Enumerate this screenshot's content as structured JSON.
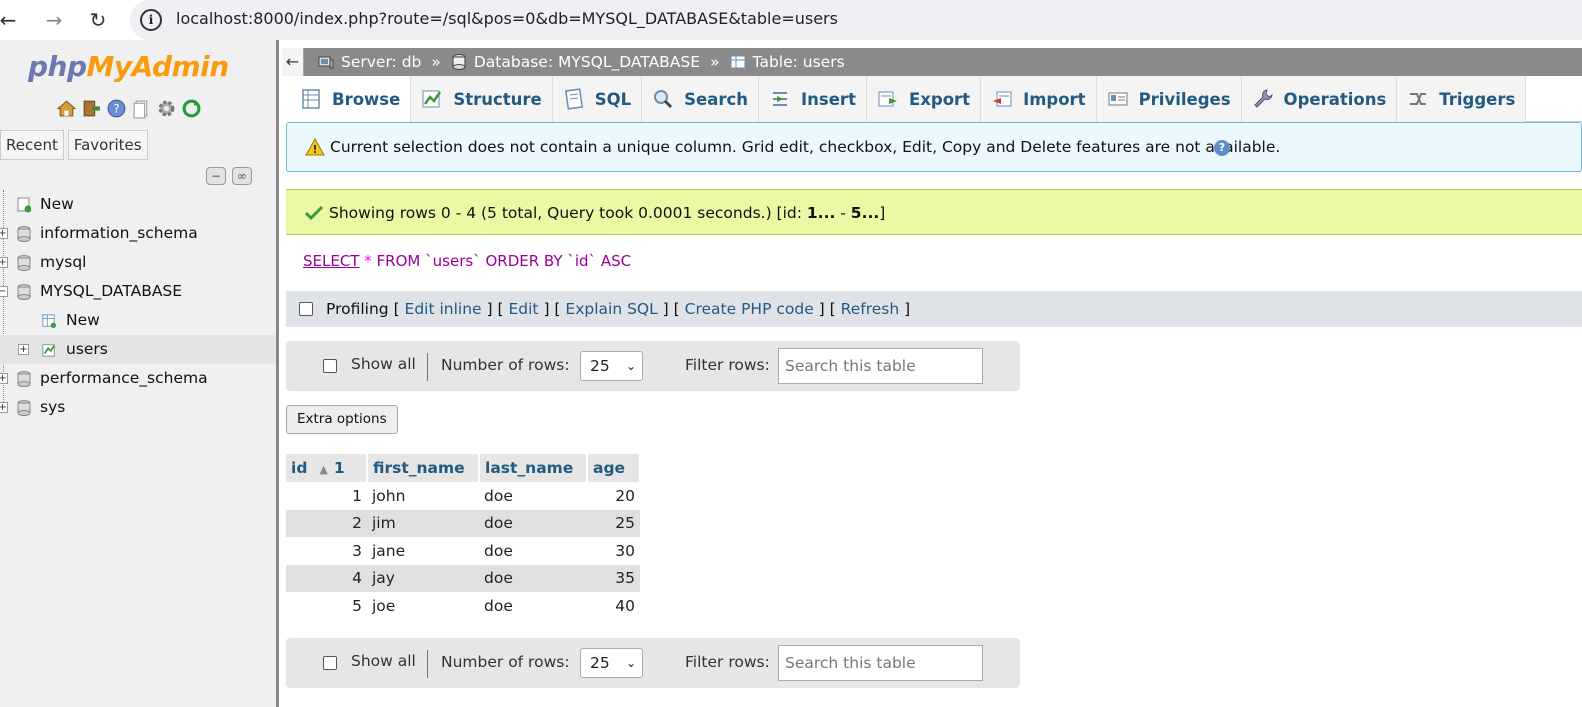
{
  "browser": {
    "url": "localhost:8000/index.php?route=/sql&pos=0&db=MYSQL_DATABASE&table=users"
  },
  "sidebar": {
    "logo_php": "php",
    "logo_myadmin": "MyAdmin",
    "tabs": [
      "Recent",
      "Favorites"
    ],
    "tree": [
      {
        "label": "New",
        "level": 0
      },
      {
        "label": "information_schema",
        "level": 0
      },
      {
        "label": "mysql",
        "level": 0
      },
      {
        "label": "MYSQL_DATABASE",
        "level": 0
      },
      {
        "label": "New",
        "level": 1
      },
      {
        "label": "users",
        "level": 1,
        "selected": true
      },
      {
        "label": "performance_schema",
        "level": 0
      },
      {
        "label": "sys",
        "level": 0
      }
    ]
  },
  "breadcrumb": {
    "server": "Server: db",
    "database": "Database: MYSQL_DATABASE",
    "table": "Table: users",
    "separator": "»"
  },
  "tabs": [
    "Browse",
    "Structure",
    "SQL",
    "Search",
    "Insert",
    "Export",
    "Import",
    "Privileges",
    "Operations",
    "Triggers"
  ],
  "notice": {
    "text": "Current selection does not contain a unique column. Grid edit, checkbox, Edit, Copy and Delete features are not available."
  },
  "success": {
    "prefix": "Showing rows 0 - 4 (5 total, Query took 0.0001 seconds.) [id: ",
    "from": "1...",
    "dash": " - ",
    "to": "5...",
    "suffix": "]"
  },
  "sql": {
    "select": "SELECT",
    "star": "*",
    "from": "FROM",
    "table": "`users`",
    "order_by": "ORDER BY",
    "column": "`id`",
    "dir": "ASC"
  },
  "profiling": {
    "label": "Profiling",
    "links": [
      "Edit inline",
      "Edit",
      "Explain SQL",
      "Create PHP code",
      "Refresh"
    ]
  },
  "navigation": {
    "show_all": "Show all",
    "number_of_rows_label": "Number of rows:",
    "number_of_rows_value": "25",
    "filter_label": "Filter rows:",
    "filter_placeholder": "Search this table"
  },
  "extra_options": "Extra options",
  "table": {
    "columns": [
      "id",
      "first_name",
      "last_name",
      "age"
    ],
    "sort_indicator": "1",
    "rows": [
      [
        "1",
        "john",
        "doe",
        "20"
      ],
      [
        "2",
        "jim",
        "doe",
        "25"
      ],
      [
        "3",
        "jane",
        "doe",
        "30"
      ],
      [
        "4",
        "jay",
        "doe",
        "35"
      ],
      [
        "5",
        "joe",
        "doe",
        "40"
      ]
    ]
  },
  "colors": {
    "link": "#235a81",
    "success_bg": "#ebf8a4",
    "notice_bg": "#ebf8fd",
    "topbar": "#8a8a8a"
  }
}
